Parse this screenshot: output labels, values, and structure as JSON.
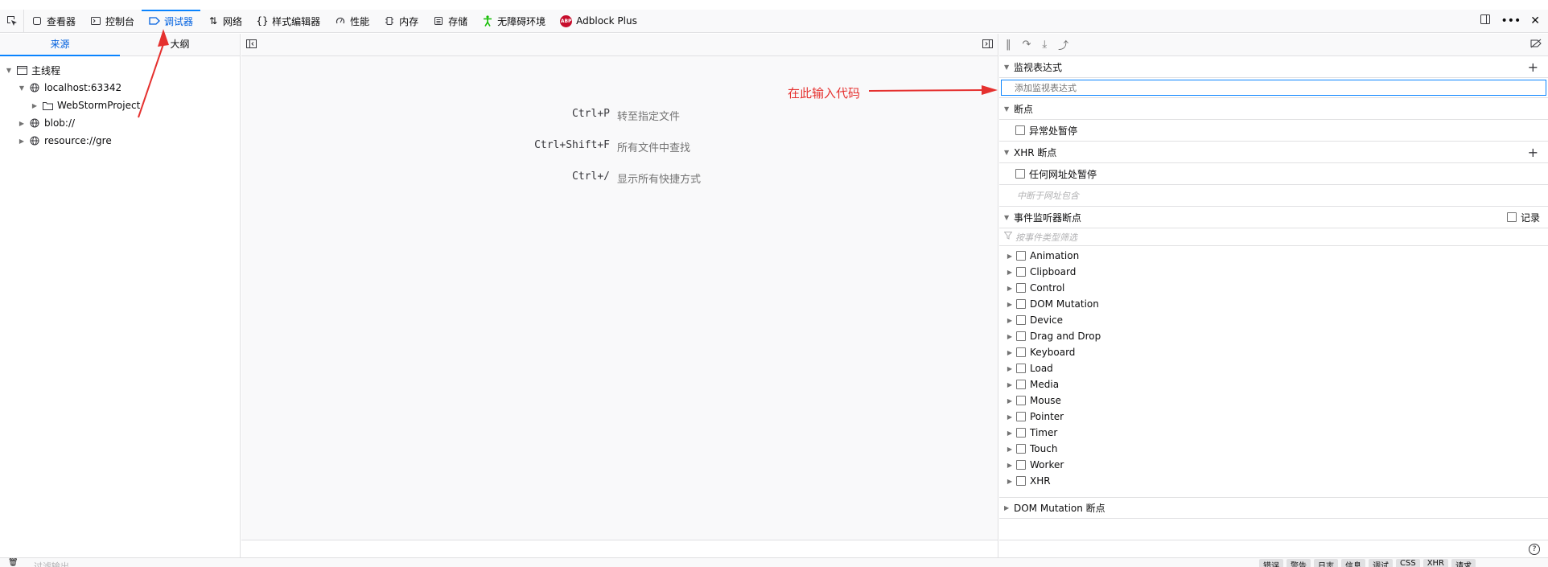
{
  "toolbar": {
    "tabs": [
      {
        "label": "查看器",
        "icon": "inspector-icon"
      },
      {
        "label": "控制台",
        "icon": "console-icon"
      },
      {
        "label": "调试器",
        "icon": "debugger-icon"
      },
      {
        "label": "网络",
        "icon": "network-icon"
      },
      {
        "label": "样式编辑器",
        "icon": "style-editor-icon"
      },
      {
        "label": "性能",
        "icon": "performance-icon"
      },
      {
        "label": "内存",
        "icon": "memory-icon"
      },
      {
        "label": "存储",
        "icon": "storage-icon"
      },
      {
        "label": "无障碍环境",
        "icon": "accessibility-icon"
      },
      {
        "label": "Adblock Plus",
        "icon": "adblock-plus-icon"
      }
    ],
    "active_tab": "调试器",
    "abp_badge": "ABP"
  },
  "left_panel": {
    "tabs": [
      "来源",
      "大纲"
    ],
    "active_tab": "来源",
    "tree": {
      "main_thread": "主线程",
      "host": "localhost:63342",
      "project_folder": "WebStormProject",
      "blob": "blob://",
      "resource": "resource://gre"
    }
  },
  "editor": {
    "shortcuts": [
      {
        "key": "Ctrl+P",
        "description": "转至指定文件"
      },
      {
        "key": "Ctrl+Shift+F",
        "description": "所有文件中查找"
      },
      {
        "key": "Ctrl+/",
        "description": "显示所有快捷方式"
      }
    ]
  },
  "right_panel": {
    "watch": {
      "title": "监视表达式",
      "placeholder": "添加监视表达式"
    },
    "breakpoints": {
      "title": "断点",
      "pause_on_exceptions": "异常处暂停"
    },
    "xhr": {
      "title": "XHR 断点",
      "pause_on_any_url": "任何网址处暂停",
      "url_placeholder": "中断于网址包含"
    },
    "event_listeners": {
      "title": "事件监听器断点",
      "log_label": "记录",
      "filter_placeholder": "按事件类型筛选",
      "categories": [
        "Animation",
        "Clipboard",
        "Control",
        "DOM Mutation",
        "Device",
        "Drag and Drop",
        "Keyboard",
        "Load",
        "Media",
        "Mouse",
        "Pointer",
        "Timer",
        "Touch",
        "Worker",
        "XHR"
      ]
    },
    "dom_mutation": {
      "title": "DOM Mutation 断点"
    }
  },
  "console": {
    "filter_placeholder": "过滤输出",
    "buttons": [
      "错误",
      "警告",
      "日志",
      "信息",
      "调试",
      "CSS",
      "XHR",
      "请求"
    ]
  },
  "annotation": {
    "text": "在此输入代码",
    "color": "#e5312f"
  },
  "colors": {
    "accent": "#0a84ff",
    "active_text": "#0060df"
  }
}
